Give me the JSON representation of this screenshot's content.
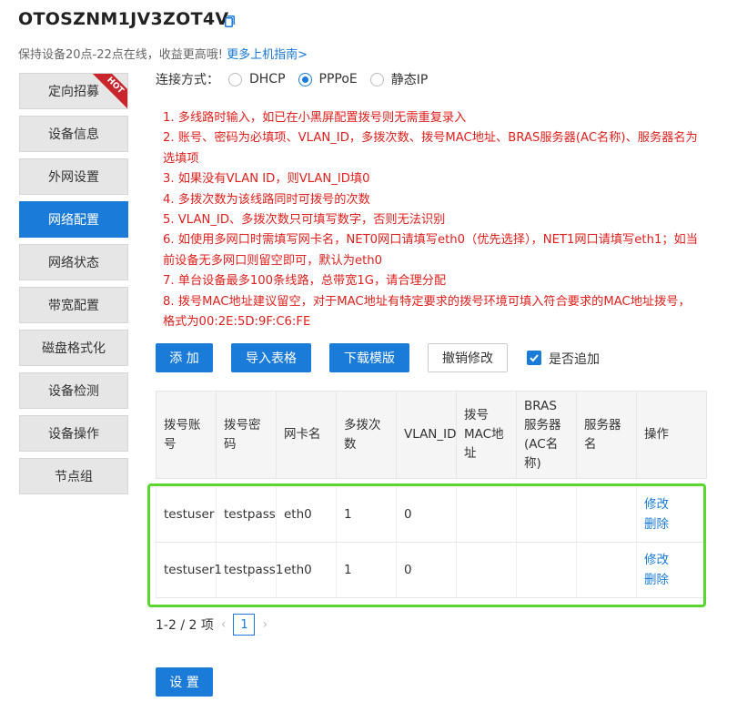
{
  "header": {
    "device_id": "OTOSZNM1JV3ZOT4V",
    "tip": "保持设备20点-22点在线，收益更高哦!",
    "guide_link": "更多上机指南>"
  },
  "sidebar": {
    "hot_badge": "HOT",
    "items": [
      {
        "label": "定向招募"
      },
      {
        "label": "设备信息"
      },
      {
        "label": "外网设置"
      },
      {
        "label": "网络配置"
      },
      {
        "label": "网络状态"
      },
      {
        "label": "带宽配置"
      },
      {
        "label": "磁盘格式化"
      },
      {
        "label": "设备检测"
      },
      {
        "label": "设备操作"
      },
      {
        "label": "节点组"
      }
    ]
  },
  "connection": {
    "label": "连接方式：",
    "options": [
      "DHCP",
      "PPPoE",
      "静态IP"
    ],
    "selected": "PPPoE"
  },
  "notes": [
    "1. 多线路时输入，如已在小黑屏配置拨号则无需重复录入",
    "2. 账号、密码为必填项、VLAN_ID，多拨次数、拨号MAC地址、BRAS服务器(AC名称)、服务器名为选填项",
    "3. 如果没有VLAN ID，则VLAN_ID填0",
    "4. 多拨次数为该线路同时可拨号的次数",
    "5. VLAN_ID、多拨次数只可填写数字，否则无法识别",
    "6. 如使用多网口时需填写网卡名，NET0网口请填写eth0（优先选择），NET1网口请填写eth1；如当前设备无多网口则留空即可，默认为eth0",
    "7. 单台设备最多100条线路，总带宽1G，请合理分配",
    "8. 拨号MAC地址建议留空，对于MAC地址有特定要求的拨号环境可填入符合要求的MAC地址拨号，格式为00:2E:5D:9F:C6:FE"
  ],
  "toolbar": {
    "add_label": "添 加",
    "import_label": "导入表格",
    "download_label": "下载模版",
    "undo_label": "撤销修改",
    "append_label": "是否追加",
    "append_checked": true
  },
  "table": {
    "headers": [
      "拨号账号",
      "拨号密码",
      "网卡名",
      "多拨次数",
      "VLAN_ID",
      "拨号MAC地址",
      "BRAS服务器(AC名称)",
      "服务器名",
      "操作"
    ],
    "rows": [
      {
        "account": "testuser",
        "password": "testpass",
        "nic": "eth0",
        "dial_count": "1",
        "vlan_id": "0",
        "mac": "",
        "bras": "",
        "server": "",
        "edit": "修改",
        "delete": "删除"
      },
      {
        "account": "testuser1",
        "password": "testpass1",
        "nic": "eth0",
        "dial_count": "1",
        "vlan_id": "0",
        "mac": "",
        "bras": "",
        "server": "",
        "edit": "修改",
        "delete": "删除"
      }
    ]
  },
  "pagination": {
    "summary": "1-2 / 2 项",
    "current_page": "1",
    "prev_icon": "chevron-left-icon",
    "next_icon": "chevron-right-icon"
  },
  "footer": {
    "set_label": "设 置"
  },
  "colors": {
    "accent": "#1a7bd8",
    "notes_red": "#e0211d",
    "highlight_green": "#5bd62f",
    "hot_red": "#c8252c"
  }
}
